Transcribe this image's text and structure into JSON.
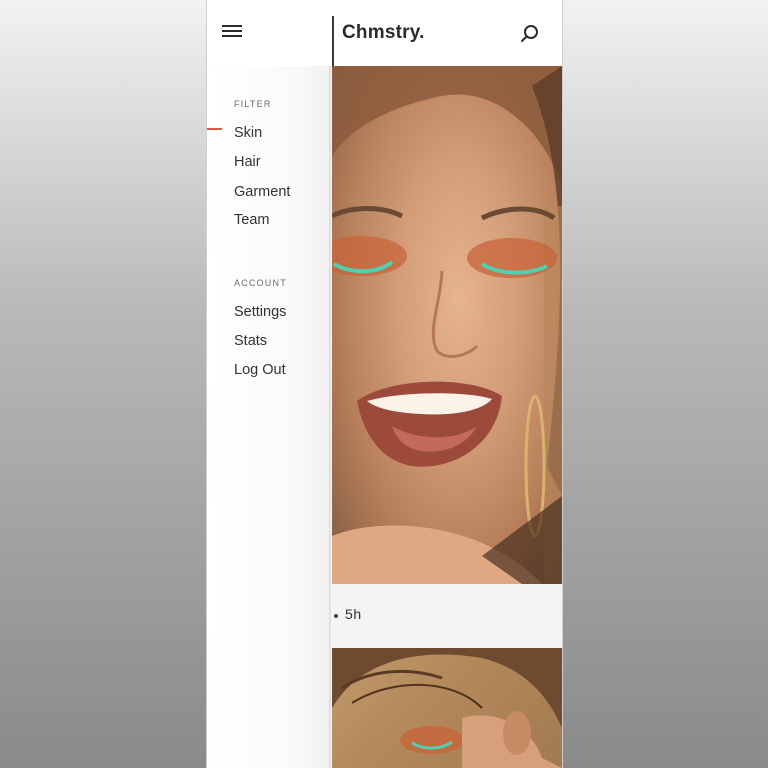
{
  "header": {
    "brand": "Chmstry."
  },
  "sidebar": {
    "filter_title": "FILTER",
    "filter_items": [
      "Skin",
      "Hair",
      "Garment",
      "Team"
    ],
    "account_title": "ACCOUNT",
    "account_items": [
      "Settings",
      "Stats",
      "Log Out"
    ],
    "active_item": "Skin"
  },
  "feed": {
    "posts": [
      {
        "time": "5h",
        "image": "smiling-woman-with-orange-and-teal-eye-makeup"
      },
      {
        "image": "woman-with-curly-hair-and-orange-eye-makeup"
      }
    ]
  },
  "icons": {
    "menu": "hamburger-menu-icon",
    "search": "search-icon"
  },
  "colors": {
    "accent": "#e2583e",
    "text": "#333333",
    "muted": "#6b6b6b"
  }
}
